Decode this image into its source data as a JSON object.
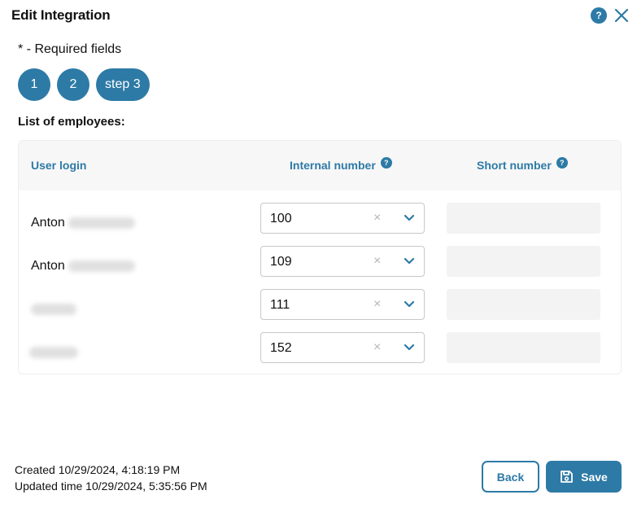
{
  "dialog": {
    "title": "Edit Integration",
    "help_label": "?",
    "required_note": "* - Required fields"
  },
  "steps": [
    {
      "label": "1"
    },
    {
      "label": "2"
    },
    {
      "label": "step 3"
    }
  ],
  "employees": {
    "title": "List of employees:",
    "headers": {
      "user_login": "User login",
      "internal_number": "Internal number",
      "short_number": "Short number",
      "help_label": "?"
    },
    "clear_glyph": "×",
    "rows": [
      {
        "login": "Anton",
        "internal_number": "100",
        "short_number": ""
      },
      {
        "login": "Anton",
        "internal_number": "109",
        "short_number": ""
      },
      {
        "login": "",
        "internal_number": "111",
        "short_number": ""
      },
      {
        "login": "",
        "internal_number": "152",
        "short_number": ""
      }
    ]
  },
  "footer": {
    "created": "Created 10/29/2024, 4:18:19 PM",
    "updated": "Updated time 10/29/2024, 5:35:56 PM",
    "back_label": "Back",
    "save_label": "Save"
  },
  "icons": {
    "help": "question-icon",
    "close": "close-icon",
    "chevron": "chevron-down-icon",
    "save": "floppy-disk-icon"
  },
  "colors": {
    "accent": "#2d7aa6",
    "header_bg": "#f7f7f7",
    "field_bg": "#f3f3f3"
  }
}
